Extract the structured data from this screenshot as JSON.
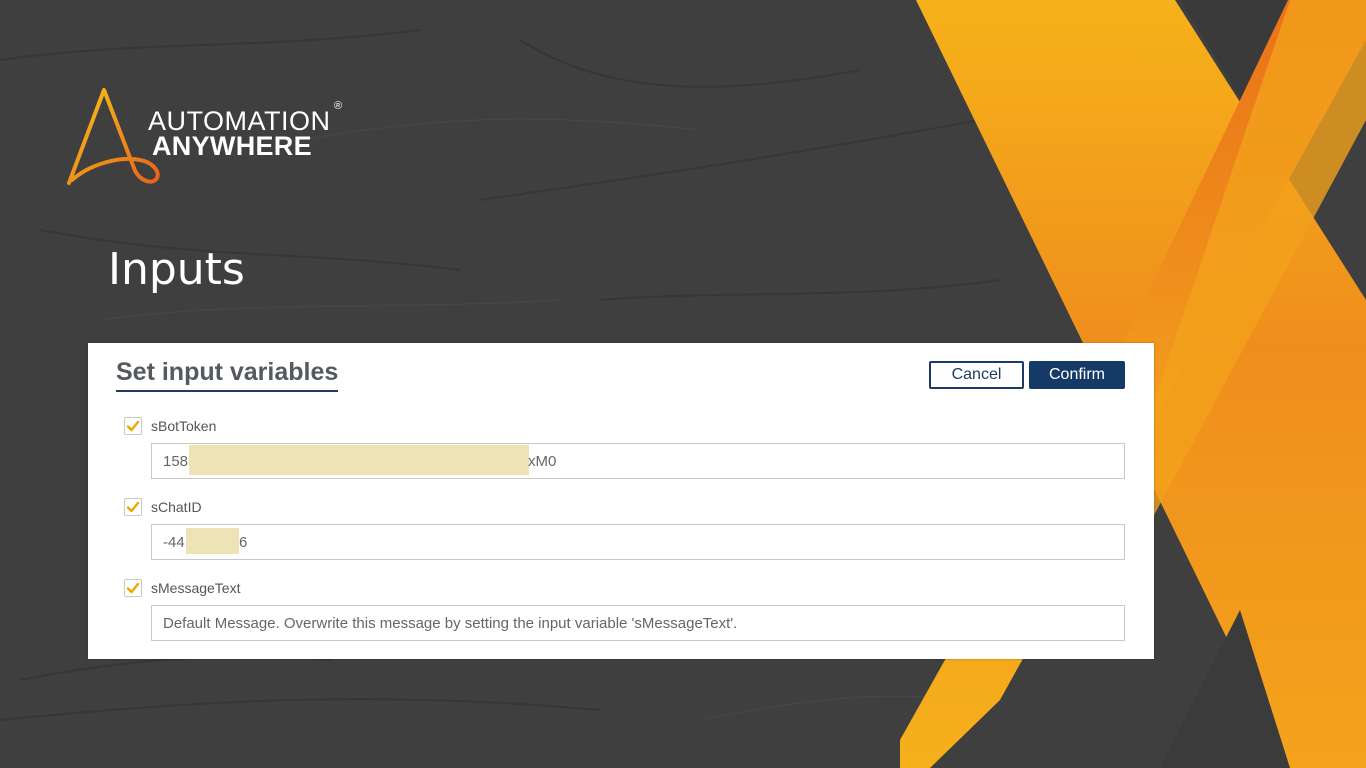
{
  "brand": {
    "line1": "AUTOMATION",
    "line2": "ANYWHERE",
    "registered": "®"
  },
  "slide": {
    "title": "Inputs"
  },
  "dialog": {
    "title": "Set input variables",
    "cancel_label": "Cancel",
    "confirm_label": "Confirm",
    "variables": [
      {
        "name": "sBotToken",
        "checked": true,
        "value_start": "158",
        "value_end": "xM0"
      },
      {
        "name": "sChatID",
        "checked": true,
        "value_start": "-44",
        "value_end": "6"
      },
      {
        "name": "sMessageText",
        "checked": true,
        "value": "Default Message. Overwrite this message by setting the input variable 'sMessageText'."
      }
    ]
  },
  "colors": {
    "background": "#3f3f3f",
    "accent_orange": "#f5a623",
    "accent_deep_orange": "#e8711a",
    "primary_navy": "#163a66",
    "checkbox": "#f0a500"
  }
}
